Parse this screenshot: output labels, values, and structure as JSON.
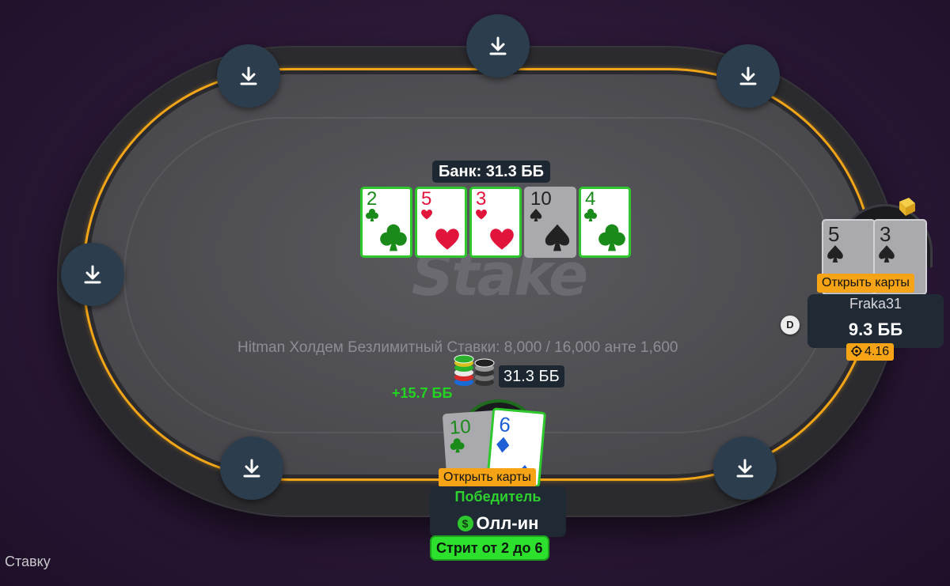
{
  "pot": {
    "label": "Банк: 31.3 ББ"
  },
  "table_info": "Hitman Холдем Безлимитный Ставки: 8,000 / 16,000 анте 1,600",
  "logo_text": "Stake",
  "board_cards": [
    {
      "rank": "2",
      "suit": "clubs"
    },
    {
      "rank": "5",
      "suit": "hearts"
    },
    {
      "rank": "3",
      "suit": "hearts"
    },
    {
      "rank": "10",
      "suit": "spades"
    },
    {
      "rank": "4",
      "suit": "clubs"
    }
  ],
  "bet": {
    "amount": "31.3 ББ"
  },
  "hero": {
    "win_amount": "+15.7 ББ",
    "cards": [
      {
        "rank": "10",
        "suit": "clubs"
      },
      {
        "rank": "6",
        "suit": "diamonds"
      }
    ],
    "show_cards_label": "Открыть карты",
    "status": "Победитель",
    "dollar_icon_text": "$",
    "action": "Олл-ин",
    "hand_description": "Стрит от 2 до 6"
  },
  "opponent": {
    "cards": [
      {
        "rank": "5",
        "suit": "spades"
      },
      {
        "rank": "3",
        "suit": "spades"
      }
    ],
    "show_cards_label": "Открыть карты",
    "name": "Fraka31",
    "stack": "9.3 ББ",
    "badge": "4.16"
  },
  "dealer_button": "D",
  "seat_buttons": [
    "seat-top-left",
    "seat-top-center",
    "seat-top-right",
    "seat-left",
    "seat-bottom-left",
    "seat-bottom-right"
  ],
  "bottom_left_text": "Ставку",
  "colors": {
    "rail": "#f2a516",
    "win_green": "#21d521",
    "badge_orange": "#f6a416",
    "panel": "#1f2a35",
    "seat_button": "#2c3d4e"
  }
}
